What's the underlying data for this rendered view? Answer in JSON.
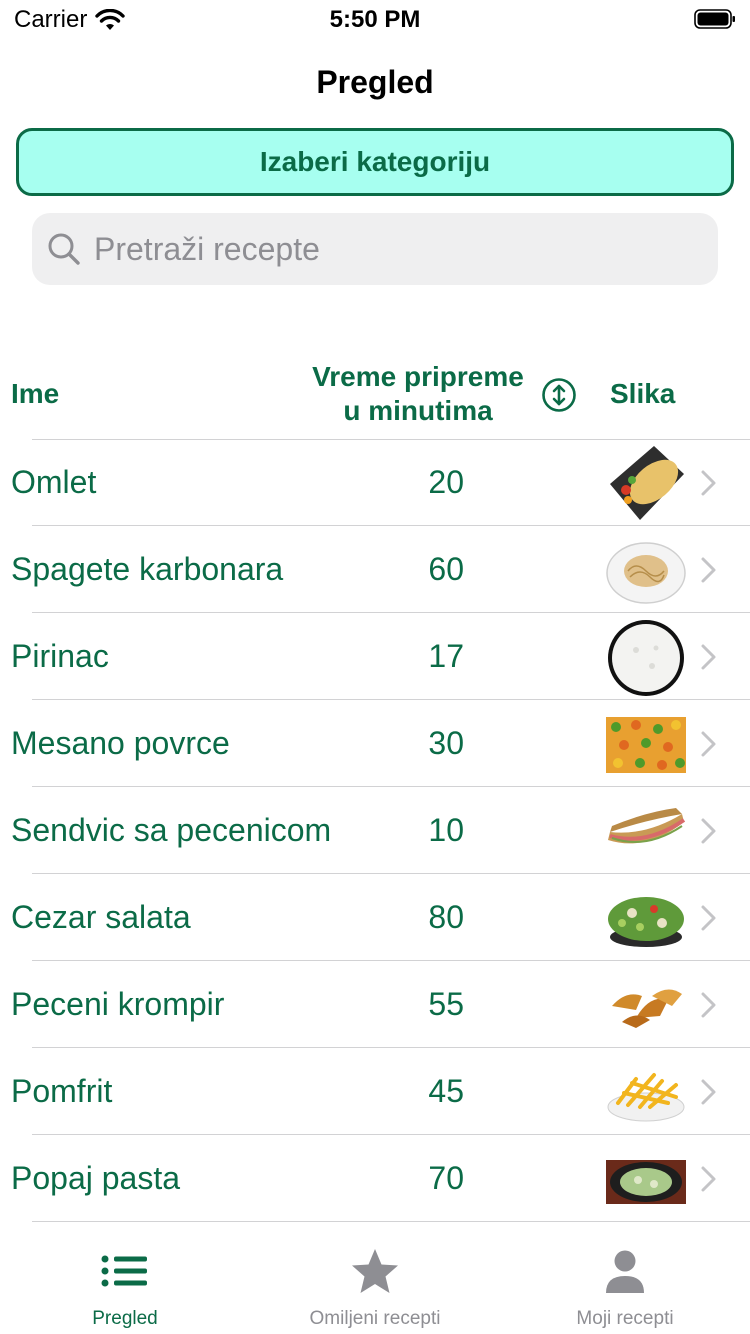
{
  "status_bar": {
    "carrier": "Carrier",
    "time": "5:50 PM"
  },
  "nav": {
    "title": "Pregled"
  },
  "category_button": {
    "label": "Izaberi kategoriju"
  },
  "search": {
    "placeholder": "Pretraži recepte"
  },
  "table": {
    "headers": {
      "name": "Ime",
      "time_line1": "Vreme pripreme",
      "time_line2": "u minutima",
      "image": "Slika"
    },
    "rows": [
      {
        "name": "Omlet",
        "time": "20",
        "thumb_icon": "omelette-plate-image"
      },
      {
        "name": "Spagete karbonara",
        "time": "60",
        "thumb_icon": "spaghetti-plate-image"
      },
      {
        "name": "Pirinac",
        "time": "17",
        "thumb_icon": "rice-bowl-image"
      },
      {
        "name": "Mesano povrce",
        "time": "30",
        "thumb_icon": "mixed-vegetables-image"
      },
      {
        "name": "Sendvic sa pecenicom",
        "time": "10",
        "thumb_icon": "sandwich-image"
      },
      {
        "name": "Cezar salata",
        "time": "80",
        "thumb_icon": "salad-bowl-image"
      },
      {
        "name": "Peceni krompir",
        "time": "55",
        "thumb_icon": "potato-wedges-image"
      },
      {
        "name": "Pomfrit",
        "time": "45",
        "thumb_icon": "fries-plate-image"
      },
      {
        "name": "Popaj pasta",
        "time": "70",
        "thumb_icon": "spinach-pasta-image"
      }
    ]
  },
  "tabs": [
    {
      "label": "Pregled",
      "icon": "list-icon",
      "active": true
    },
    {
      "label": "Omiljeni recepti",
      "icon": "star-icon",
      "active": false
    },
    {
      "label": "Moji recepti",
      "icon": "person-icon",
      "active": false
    }
  ],
  "colors": {
    "accent": "#0b6b47",
    "button_fill": "#a7fff0",
    "inactive": "#8e8e93"
  }
}
